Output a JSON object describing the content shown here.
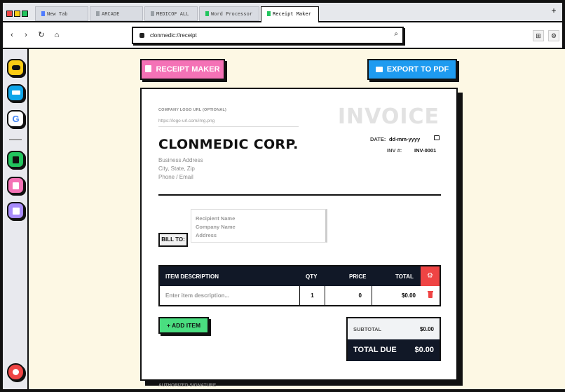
{
  "browser": {
    "tabs": [
      {
        "label": "New Tab",
        "color": "#4f7cff"
      },
      {
        "label": "ARCADE",
        "color": "#9aa0a6"
      },
      {
        "label": "MEDICOF ALL",
        "color": "#9aa0a6"
      },
      {
        "label": "Word Processor",
        "color": "#22c55e"
      },
      {
        "label": "Receipt Maker",
        "color": "#22c55e"
      }
    ],
    "new_tab_label": "+",
    "url": "clonmedic://receipt",
    "icons": {
      "back": "chevron-left-icon",
      "forward": "chevron-right-icon",
      "reload": "reload-icon",
      "home": "home-icon",
      "search": "search-icon",
      "extensions": "sitemap-icon",
      "settings": "gear-icon"
    }
  },
  "sidebar": {
    "apps": [
      {
        "name": "gamepad",
        "color": "#facc15"
      },
      {
        "name": "graduation-cap",
        "color": "#0ea5e9"
      },
      {
        "name": "google",
        "color": "#ffffff"
      },
      {
        "name": "word-doc",
        "color": "#22c55e"
      },
      {
        "name": "receipt",
        "color": "#f472b6"
      },
      {
        "name": "calendar",
        "color": "#a78bfa"
      }
    ],
    "profile": {
      "name": "user",
      "color": "#ef4444"
    }
  },
  "toolbar": {
    "receipt_maker_label": "RECEIPT MAKER",
    "export_label": "EXPORT TO PDF",
    "receipt_color": "#f472b6",
    "export_color": "#1e9bf0"
  },
  "invoice": {
    "logo_label": "COMPANY LOGO URL (OPTIONAL)",
    "logo_placeholder": "https://logo-url.com/img.png",
    "title": "INVOICE",
    "company_name": "CLONMEDIC CORP.",
    "address_lines": [
      "Business Address",
      "City, State, Zip",
      "Phone / Email"
    ],
    "date_label": "DATE:",
    "date_value": "dd-mm-yyyy",
    "inv_label": "INV #:",
    "inv_value": "INV-0001",
    "bill_to_label": "BILL TO:",
    "recipient_lines": [
      "Recipient Name",
      "Company Name",
      "Address"
    ],
    "table": {
      "headers": {
        "description": "ITEM DESCRIPTION",
        "qty": "QTY",
        "price": "PRICE",
        "total": "TOTAL"
      },
      "rows": [
        {
          "description": "Enter item description...",
          "qty": "1",
          "price": "0",
          "total": "$0.00"
        }
      ]
    },
    "add_item_label": "+ ADD ITEM",
    "subtotal_label": "SUBTOTAL",
    "subtotal_value": "$0.00",
    "total_due_label": "TOTAL DUE",
    "total_due_value": "$0.00",
    "signature_label": "AUTHORIZED SIGNATURE"
  }
}
